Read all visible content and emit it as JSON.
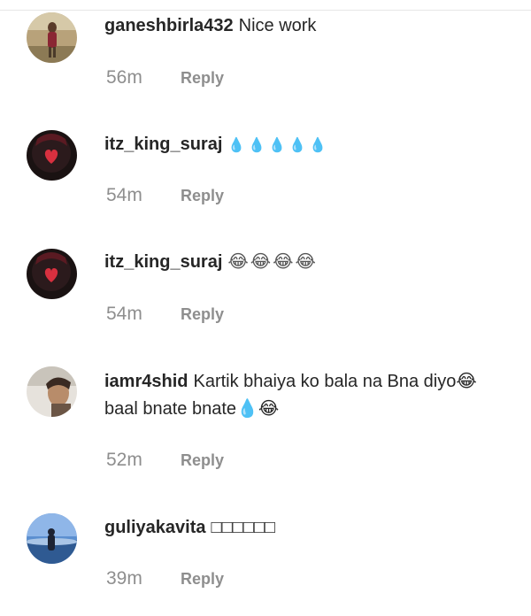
{
  "comments": [
    {
      "username": "ganeshbirla432",
      "text": "Nice work",
      "time": "56m",
      "reply_label": "Reply",
      "avatar_icon": "user-avatar-standing-figure"
    },
    {
      "username": "itz_king_suraj",
      "text": "💧💧💧💧💧",
      "time": "54m",
      "reply_label": "Reply",
      "avatar_icon": "user-avatar-heart"
    },
    {
      "username": "itz_king_suraj",
      "text": "😂😂😂😂",
      "time": "54m",
      "reply_label": "Reply",
      "avatar_icon": "user-avatar-heart"
    },
    {
      "username": "iamr4shid",
      "text": "Kartik bhaiya ko bala na Bna diyo😂 baal bnate bnate💧😂",
      "time": "52m",
      "reply_label": "Reply",
      "avatar_icon": "user-avatar-portrait"
    },
    {
      "username": "guliyakavita",
      "text": "□□□□□□",
      "time": "39m",
      "reply_label": "Reply",
      "avatar_icon": "user-avatar-landscape"
    }
  ],
  "colors": {
    "text": "#262626",
    "secondary": "#8e8e8e"
  }
}
